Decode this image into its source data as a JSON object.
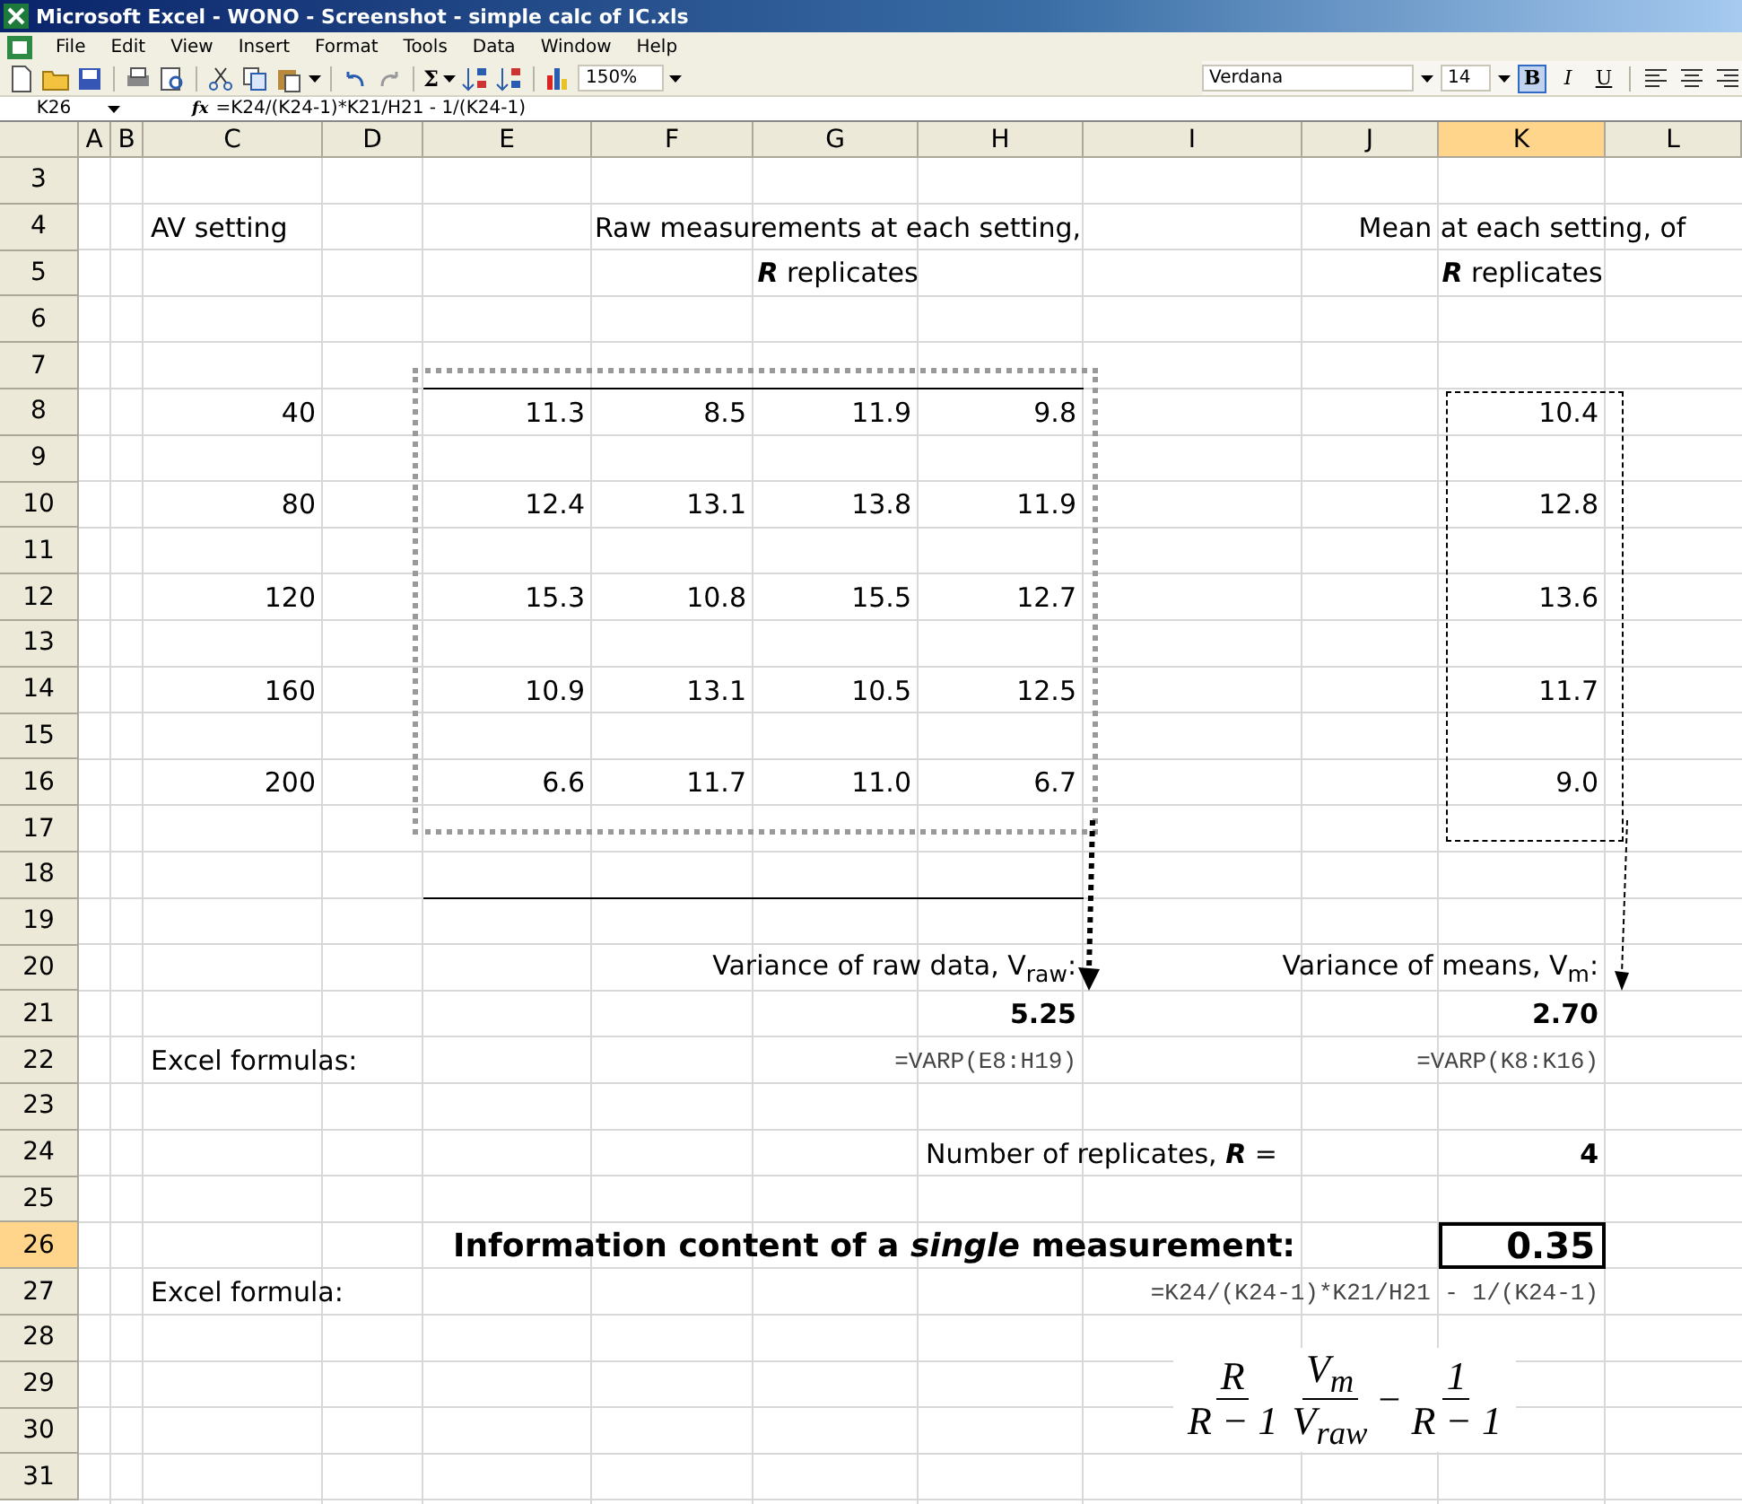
{
  "window": {
    "title": "Microsoft Excel - WONO - Screenshot - simple calc of IC.xls"
  },
  "menu": [
    "File",
    "Edit",
    "View",
    "Insert",
    "Format",
    "Tools",
    "Data",
    "Window",
    "Help"
  ],
  "standard_toolbar": {
    "sum": "Σ",
    "zoom": "150%"
  },
  "formatting_toolbar": {
    "font": "Verdana",
    "size": "14",
    "styles": [
      {
        "label": "B",
        "selected": true
      },
      {
        "label": "I",
        "selected": false
      },
      {
        "label": "U",
        "selected": false
      }
    ]
  },
  "formula_bar": {
    "name_box": "K26",
    "function_label": "fx",
    "formula": "=K24/(K24-1)*K21/H21  -  1/(K24-1)"
  },
  "sheet": {
    "columns": [
      {
        "label": "A",
        "selected": false
      },
      {
        "label": "B",
        "selected": false
      },
      {
        "label": "C",
        "selected": false
      },
      {
        "label": "D",
        "selected": false
      },
      {
        "label": "E",
        "selected": false
      },
      {
        "label": "F",
        "selected": false
      },
      {
        "label": "G",
        "selected": false
      },
      {
        "label": "H",
        "selected": false
      },
      {
        "label": "I",
        "selected": false
      },
      {
        "label": "J",
        "selected": false
      },
      {
        "label": "K",
        "selected": true
      },
      {
        "label": "L",
        "selected": false
      }
    ],
    "rows": [
      {
        "label": "3",
        "selected": false
      },
      {
        "label": "4",
        "selected": false,
        "cells": [
          null,
          null,
          {
            "text": "AV setting",
            "kind": "text"
          },
          null,
          null,
          null,
          {
            "text": "Raw measurements at each setting,",
            "kind": "caption"
          },
          null,
          null,
          null,
          {
            "text": "Mean at each setting, of",
            "kind": "caption"
          }
        ]
      },
      {
        "label": "5",
        "selected": false,
        "cells": [
          null,
          null,
          null,
          null,
          null,
          null,
          {
            "text": "**R** replicates",
            "kind": "caption"
          },
          null,
          null,
          null,
          {
            "text": "**R** replicates",
            "kind": "caption"
          }
        ]
      },
      {
        "label": "6",
        "selected": false
      },
      {
        "label": "7",
        "selected": false
      },
      {
        "label": "8",
        "selected": false,
        "cells": [
          null,
          null,
          {
            "text": "40",
            "kind": "number"
          },
          null,
          {
            "text": "11.3",
            "kind": "number"
          },
          {
            "text": "8.5",
            "kind": "number"
          },
          {
            "text": "11.9",
            "kind": "number"
          },
          {
            "text": "9.8",
            "kind": "number"
          },
          null,
          null,
          {
            "text": "10.4",
            "kind": "number"
          }
        ]
      },
      {
        "label": "9",
        "selected": false
      },
      {
        "label": "10",
        "selected": false,
        "cells": [
          null,
          null,
          {
            "text": "80",
            "kind": "number"
          },
          null,
          {
            "text": "12.4",
            "kind": "number"
          },
          {
            "text": "13.1",
            "kind": "number"
          },
          {
            "text": "13.8",
            "kind": "number"
          },
          {
            "text": "11.9",
            "kind": "number"
          },
          null,
          null,
          {
            "text": "12.8",
            "kind": "number"
          }
        ]
      },
      {
        "label": "11",
        "selected": false
      },
      {
        "label": "12",
        "selected": false,
        "cells": [
          null,
          null,
          {
            "text": "120",
            "kind": "number"
          },
          null,
          {
            "text": "15.3",
            "kind": "number"
          },
          {
            "text": "10.8",
            "kind": "number"
          },
          {
            "text": "15.5",
            "kind": "number"
          },
          {
            "text": "12.7",
            "kind": "number"
          },
          null,
          null,
          {
            "text": "13.6",
            "kind": "number"
          }
        ]
      },
      {
        "label": "13",
        "selected": false
      },
      {
        "label": "14",
        "selected": false,
        "cells": [
          null,
          null,
          {
            "text": "160",
            "kind": "number"
          },
          null,
          {
            "text": "10.9",
            "kind": "number"
          },
          {
            "text": "13.1",
            "kind": "number"
          },
          {
            "text": "10.5",
            "kind": "number"
          },
          {
            "text": "12.5",
            "kind": "number"
          },
          null,
          null,
          {
            "text": "11.7",
            "kind": "number"
          }
        ]
      },
      {
        "label": "15",
        "selected": false
      },
      {
        "label": "16",
        "selected": false,
        "cells": [
          null,
          null,
          {
            "text": "200",
            "kind": "number"
          },
          null,
          {
            "text": "6.6",
            "kind": "number"
          },
          {
            "text": "11.7",
            "kind": "number"
          },
          {
            "text": "11.0",
            "kind": "number"
          },
          {
            "text": "6.7",
            "kind": "number"
          },
          null,
          null,
          {
            "text": "9.0",
            "kind": "number"
          }
        ]
      },
      {
        "label": "17",
        "selected": false
      },
      {
        "label": "18",
        "selected": false
      },
      {
        "label": "19",
        "selected": false
      },
      {
        "label": "20",
        "selected": false,
        "cells": [
          null,
          null,
          null,
          null,
          null,
          null,
          null,
          {
            "text": "Variance of raw data, V$_{raw}$:",
            "kind": "note"
          },
          null,
          null,
          {
            "text": "Variance of means, V$_{m}$:",
            "kind": "note"
          }
        ]
      },
      {
        "label": "21",
        "selected": false,
        "cells": [
          null,
          null,
          null,
          null,
          null,
          null,
          null,
          {
            "text": "5.25",
            "kind": "result"
          },
          null,
          null,
          {
            "text": "2.70",
            "kind": "result"
          }
        ]
      },
      {
        "label": "22",
        "selected": false,
        "cells": [
          null,
          null,
          {
            "text": "Excel formulas:",
            "kind": "text"
          },
          null,
          null,
          null,
          null,
          {
            "text": "=VARP(E8:H19)",
            "kind": "formula"
          },
          null,
          null,
          {
            "text": "=VARP(K8:K16)",
            "kind": "formula"
          }
        ]
      },
      {
        "label": "23",
        "selected": false
      },
      {
        "label": "24",
        "selected": false,
        "cells": [
          null,
          null,
          null,
          null,
          null,
          null,
          null,
          {
            "text": "Number of replicates, **R** =",
            "kind": "text"
          },
          null,
          null,
          {
            "text": "4",
            "kind": "result"
          }
        ]
      },
      {
        "label": "25",
        "selected": false
      },
      {
        "label": "26",
        "selected": true,
        "cells": [
          null,
          null,
          null,
          null,
          null,
          null,
          null,
          null,
          {
            "text": "Information content of a *single* measurement:",
            "kind": "heading"
          },
          null,
          {
            "text": "0.35",
            "kind": "answer"
          }
        ]
      },
      {
        "label": "27",
        "selected": false,
        "cells": [
          null,
          null,
          {
            "text": "Excel formula:",
            "kind": "text"
          },
          null,
          null,
          null,
          null,
          null,
          null,
          null,
          {
            "text": "=K24/(K24-1)*K21/H21  -  1/(K24-1)",
            "kind": "formula"
          }
        ]
      },
      {
        "label": "28",
        "selected": false
      },
      {
        "label": "29",
        "selected": false
      },
      {
        "label": "30",
        "selected": false
      },
      {
        "label": "31",
        "selected": false
      }
    ],
    "equation": [
      {
        "kind": "fraction",
        "numerator": "R",
        "denominator": "R − 1"
      },
      {
        "kind": "fraction",
        "numerator": "V$_{m}$",
        "denominator": "V$_{raw}$"
      },
      {
        "kind": "operator",
        "symbol": "−"
      },
      {
        "kind": "fraction",
        "numerator": "1",
        "denominator": "R − 1"
      }
    ]
  }
}
